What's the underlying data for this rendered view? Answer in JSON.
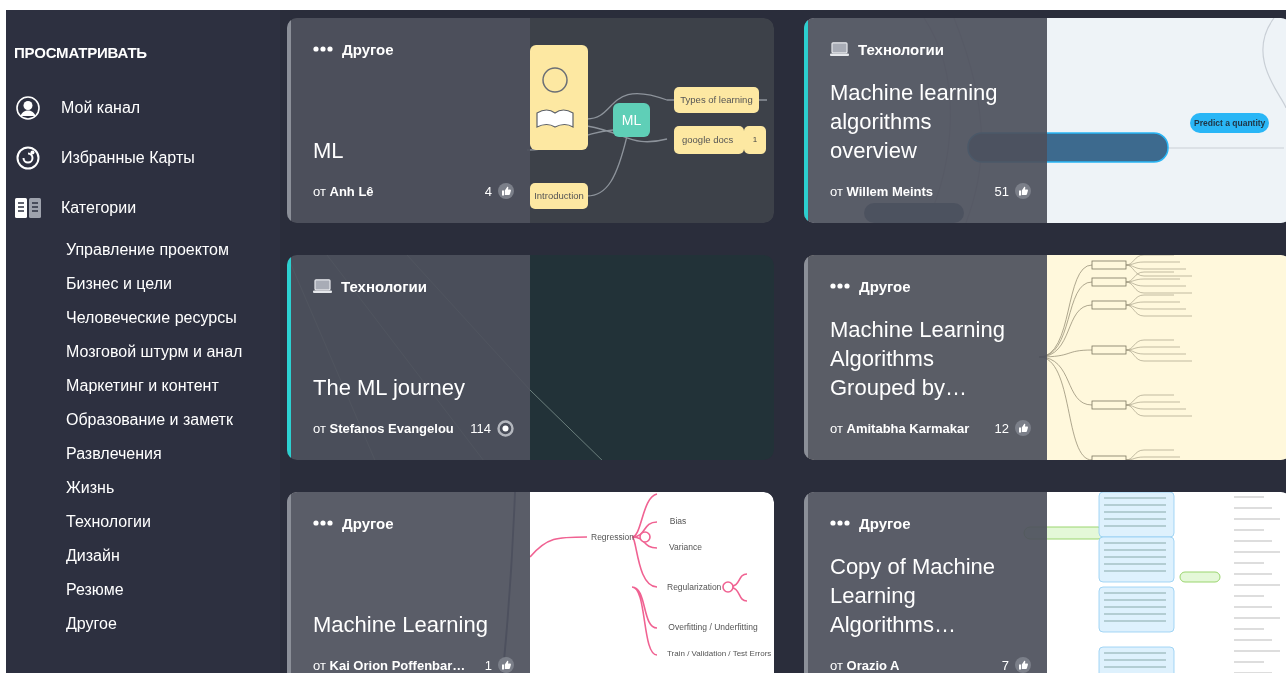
{
  "sidebar": {
    "heading": "ПРОСМАТРИВАТЬ",
    "items": [
      {
        "label": "Мой канал"
      },
      {
        "label": "Избранные Карты"
      },
      {
        "label": "Категории"
      }
    ],
    "categories": [
      "Управление проектом",
      "Бизнес и цели",
      "Человеческие ресурсы",
      "Мозговой штурм и анал",
      "Маркетинг и контент",
      "Образование и заметк",
      "Развлечения",
      "Жизнь",
      "Технологии",
      "Дизайн",
      "Резюме",
      "Другое"
    ]
  },
  "cards": [
    {
      "category": "Другое",
      "kind": "other",
      "color": "#8b8f98",
      "title": "ML",
      "author_prefix": "от",
      "author": "Anh Lê",
      "count": "4",
      "views": false,
      "preview_nodes": [
        "ML",
        "Types of learning",
        "google docs",
        "1",
        "Introduction"
      ]
    },
    {
      "category": "Технологии",
      "kind": "technology",
      "color": "#2ccfcf",
      "title": "Machine learning algorithms overview",
      "author_prefix": "от",
      "author": "Willem Meints",
      "count": "51",
      "views": false,
      "preview_nodes": [
        "Predict a quantity"
      ]
    },
    {
      "category": "Технологии",
      "kind": "technology",
      "color": "#2ccfcf",
      "title": "The ML journey",
      "author_prefix": "от",
      "author": "Stefanos Evangelou",
      "count": "114",
      "views": true
    },
    {
      "category": "Другое",
      "kind": "other",
      "color": "#8b8f98",
      "title": "Machine Learning Algorithms Grouped by…",
      "author_prefix": "от",
      "author": "Amitabha Karmakar",
      "count": "12",
      "views": false
    },
    {
      "category": "Другое",
      "kind": "other",
      "color": "#8b8f98",
      "title": "Machine Learning",
      "author_prefix": "от",
      "author": "Kai Orion Poffenbar…",
      "count": "1",
      "views": false,
      "preview_nodes": [
        "Regression",
        "Bias",
        "Variance",
        "Regularization",
        "Overfitting / Underfitting",
        "Train / Validation / Test Errors"
      ]
    },
    {
      "category": "Другое",
      "kind": "other",
      "color": "#8b8f98",
      "title": "Copy of Machine Learning Algorithms…",
      "author_prefix": "от",
      "author": "Orazio A",
      "count": "7",
      "views": false
    }
  ]
}
